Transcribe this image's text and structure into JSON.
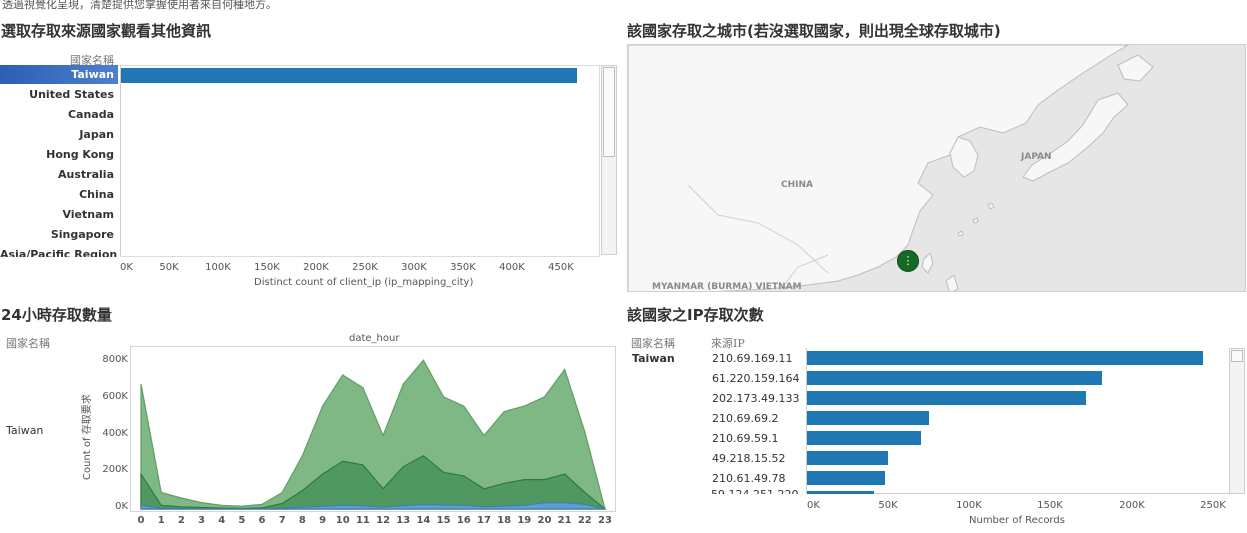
{
  "intro_text": "透過視覺化呈現，清楚提供您掌握使用者來自何種地方。",
  "panel_country": {
    "title": "選取存取來源國家觀看其他資訊",
    "header": "國家名稱",
    "countries": [
      "Taiwan",
      "United States",
      "Canada",
      "Japan",
      "Hong Kong",
      "Australia",
      "China",
      "Vietnam",
      "Singapore",
      "Asia/Pacific Region"
    ],
    "selected": "Taiwan",
    "x_axis_title": "Distinct count of client_ip (ip_mapping_city)",
    "x_ticks": [
      "0K",
      "50K",
      "100K",
      "150K",
      "200K",
      "250K",
      "300K",
      "350K",
      "400K",
      "450K"
    ]
  },
  "panel_map": {
    "title": "該國家存取之城市(若沒選取國家，則出現全球存取城市)",
    "labels": {
      "china": "CHINA",
      "japan": "JAPAN",
      "myanmar": "MYANMAR (BURMA)  VIETNAM"
    },
    "marker_glyph": "⋮"
  },
  "panel_hourly": {
    "title": "24小時存取數量",
    "header": "國家名稱",
    "column_header": "date_hour",
    "row_label": "Taiwan",
    "y_axis_title": "Count of 存取要求",
    "y_ticks": [
      "800K",
      "600K",
      "400K",
      "200K",
      "0K"
    ],
    "x_ticks": [
      "0",
      "1",
      "2",
      "3",
      "4",
      "5",
      "6",
      "7",
      "8",
      "9",
      "10",
      "11",
      "12",
      "13",
      "14",
      "15",
      "16",
      "17",
      "18",
      "19",
      "20",
      "21",
      "22",
      "23"
    ]
  },
  "panel_ip": {
    "title": "該國家之IP存取次數",
    "header_country": "國家名稱",
    "header_ip": "來源IP",
    "country": "Taiwan",
    "ips": [
      "210.69.169.11",
      "61.220.159.164",
      "202.173.49.133",
      "210.69.69.2",
      "210.69.59.1",
      "49.218.15.52",
      "210.61.49.78"
    ],
    "x_axis_title": "Number of Records",
    "x_ticks": [
      "0K",
      "50K",
      "100K",
      "150K",
      "200K",
      "250K"
    ]
  },
  "chart_data": [
    {
      "type": "bar",
      "orientation": "horizontal",
      "categories": [
        "Taiwan"
      ],
      "values": [
        465000
      ],
      "xlabel": "Distinct count of client_ip (ip_mapping_city)",
      "xlim": [
        0,
        490000
      ]
    },
    {
      "type": "area",
      "x": [
        0,
        1,
        2,
        3,
        4,
        5,
        6,
        7,
        8,
        9,
        10,
        11,
        12,
        13,
        14,
        15,
        16,
        17,
        18,
        19,
        20,
        21,
        22,
        23
      ],
      "series": [
        {
          "name": "",
          "color": "#7fb785",
          "values": [
            680,
            90,
            60,
            35,
            20,
            15,
            25,
            90,
            290,
            560,
            730,
            660,
            400,
            680,
            810,
            610,
            560,
            400,
            530,
            560,
            610,
            760,
            420,
            0
          ]
        },
        {
          "name": "",
          "color": "#4f9960",
          "values": [
            190,
            20,
            12,
            8,
            5,
            4,
            6,
            30,
            100,
            190,
            260,
            240,
            110,
            230,
            290,
            200,
            180,
            110,
            140,
            160,
            160,
            190,
            90,
            0
          ]
        },
        {
          "name": "",
          "color": "#5f9fd0",
          "values": [
            20,
            5,
            3,
            2,
            1,
            1,
            1,
            5,
            10,
            15,
            20,
            18,
            10,
            18,
            25,
            22,
            20,
            12,
            15,
            20,
            35,
            35,
            25,
            0
          ]
        }
      ],
      "ylabel": "Count of 存取要求",
      "ylim": [
        0,
        860
      ]
    },
    {
      "type": "bar",
      "orientation": "horizontal",
      "categories": [
        "210.69.169.11",
        "61.220.159.164",
        "202.173.49.133",
        "210.69.69.2",
        "210.69.59.1",
        "49.218.15.52",
        "210.61.49.78"
      ],
      "values": [
        244000,
        182000,
        172000,
        75000,
        70000,
        50000,
        48000
      ],
      "xlabel": "Number of Records",
      "xlim": [
        0,
        260000
      ]
    }
  ]
}
